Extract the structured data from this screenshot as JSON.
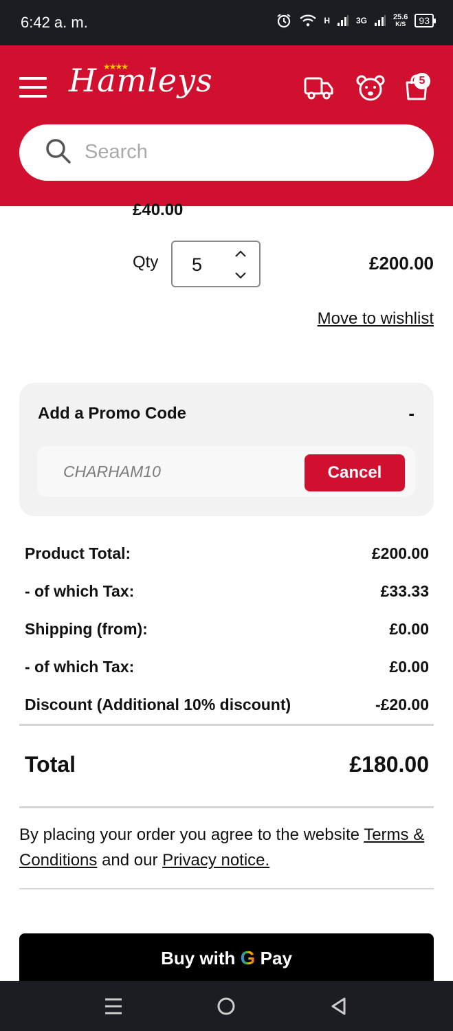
{
  "status_bar": {
    "time": "6:42 a. m.",
    "network_h": "H",
    "network_3g": "3G",
    "speed_value": "25.6",
    "speed_unit": "K/S",
    "battery": "93"
  },
  "header": {
    "logo": "Hamleys",
    "cart_count": "5",
    "search_placeholder": "Search",
    "brand_color": "#d0102e"
  },
  "line_item": {
    "unit_price": "£40.00",
    "qty_label": "Qty",
    "qty_value": "5",
    "line_total": "£200.00",
    "wishlist_link": "Move to wishlist"
  },
  "promo": {
    "title": "Add a Promo Code",
    "toggle": "-",
    "code_value": "CHARHAM10",
    "cancel_label": "Cancel"
  },
  "summary": {
    "rows": [
      {
        "label": "Product Total:",
        "value": "£200.00"
      },
      {
        "label": "- of which Tax:",
        "value": "£33.33"
      },
      {
        "label": "Shipping (from):",
        "value": "£0.00"
      },
      {
        "label": "- of which Tax:",
        "value": "£0.00"
      },
      {
        "label": "Discount (Additional 10% discount)",
        "value": "-£20.00"
      }
    ],
    "total_label": "Total",
    "total_value": "£180.00"
  },
  "terms": {
    "prefix": "By placing your order you agree to the website ",
    "terms_link": "Terms & Conditions",
    "middle": " and our ",
    "privacy_link": "Privacy notice."
  },
  "gpay": {
    "buy_with": "Buy with",
    "g": "G",
    "pay": "Pay"
  }
}
